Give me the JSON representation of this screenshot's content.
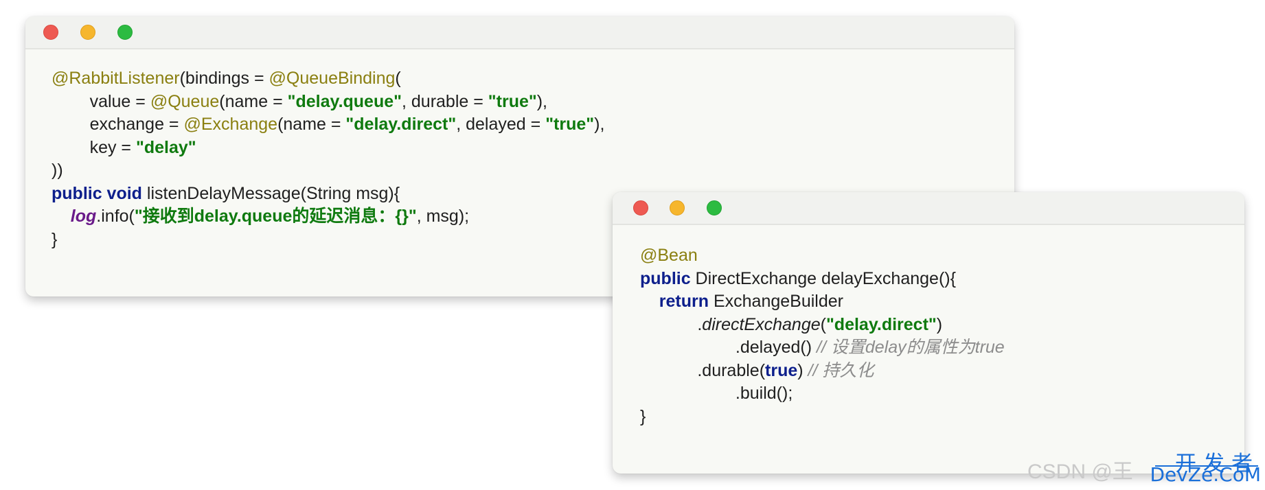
{
  "window1": {
    "lines": [
      [
        {
          "c": "ann",
          "t": "@RabbitListener"
        },
        {
          "c": "",
          "t": "(bindings = "
        },
        {
          "c": "ann",
          "t": "@QueueBinding"
        },
        {
          "c": "",
          "t": "("
        }
      ],
      [
        {
          "c": "",
          "t": "        value = "
        },
        {
          "c": "ann",
          "t": "@Queue"
        },
        {
          "c": "",
          "t": "(name = "
        },
        {
          "c": "str",
          "t": "\"delay.queue\""
        },
        {
          "c": "",
          "t": ", durable = "
        },
        {
          "c": "str",
          "t": "\"true\""
        },
        {
          "c": "",
          "t": "),"
        }
      ],
      [
        {
          "c": "",
          "t": "        exchange = "
        },
        {
          "c": "ann",
          "t": "@Exchange"
        },
        {
          "c": "",
          "t": "(name = "
        },
        {
          "c": "str",
          "t": "\"delay.direct\""
        },
        {
          "c": "",
          "t": ", delayed = "
        },
        {
          "c": "str",
          "t": "\"true\""
        },
        {
          "c": "",
          "t": "),"
        }
      ],
      [
        {
          "c": "",
          "t": "        key = "
        },
        {
          "c": "str",
          "t": "\"delay\""
        }
      ],
      [
        {
          "c": "",
          "t": "))"
        }
      ],
      [
        {
          "c": "kw",
          "t": "public void"
        },
        {
          "c": "",
          "t": " listenDelayMessage(String msg){"
        }
      ],
      [
        {
          "c": "",
          "t": "    "
        },
        {
          "c": "fld",
          "t": "log"
        },
        {
          "c": "",
          "t": ".info("
        },
        {
          "c": "str",
          "t": "\"接收到delay.queue的延迟消息：{}\""
        },
        {
          "c": "",
          "t": ", msg);"
        }
      ],
      [
        {
          "c": "",
          "t": "}"
        }
      ]
    ]
  },
  "window2": {
    "lines": [
      [
        {
          "c": "ann",
          "t": "@Bean"
        }
      ],
      [
        {
          "c": "kw",
          "t": "public"
        },
        {
          "c": "",
          "t": " DirectExchange delayExchange(){"
        }
      ],
      [
        {
          "c": "",
          "t": "    "
        },
        {
          "c": "kw",
          "t": "return"
        },
        {
          "c": "",
          "t": " ExchangeBuilder"
        }
      ],
      [
        {
          "c": "",
          "t": "            ."
        },
        {
          "c": "it",
          "t": "directExchange"
        },
        {
          "c": "",
          "t": "("
        },
        {
          "c": "str",
          "t": "\"delay.direct\""
        },
        {
          "c": "",
          "t": ")"
        }
      ],
      [
        {
          "c": "",
          "t": "                    .delayed() "
        },
        {
          "c": "cmt",
          "t": "// 设置delay的属性为true"
        }
      ],
      [
        {
          "c": "",
          "t": "            .durable("
        },
        {
          "c": "kw",
          "t": "true"
        },
        {
          "c": "",
          "t": ") "
        },
        {
          "c": "cmt",
          "t": "// 持久化"
        }
      ],
      [
        {
          "c": "",
          "t": "                    .build();"
        }
      ],
      [
        {
          "c": "",
          "t": "}"
        }
      ]
    ]
  },
  "watermark": {
    "csdn": "CSDN @王",
    "logo_top": "开发者",
    "logo_bottom": "DevZe.CoM"
  },
  "colors": {
    "annotation": "#8a7f10",
    "string": "#0f7a0f",
    "keyword": "#0d1f8c",
    "field": "#6a1b8a",
    "comment": "#8c8c8c",
    "watermark_logo": "#1a6fd9"
  }
}
